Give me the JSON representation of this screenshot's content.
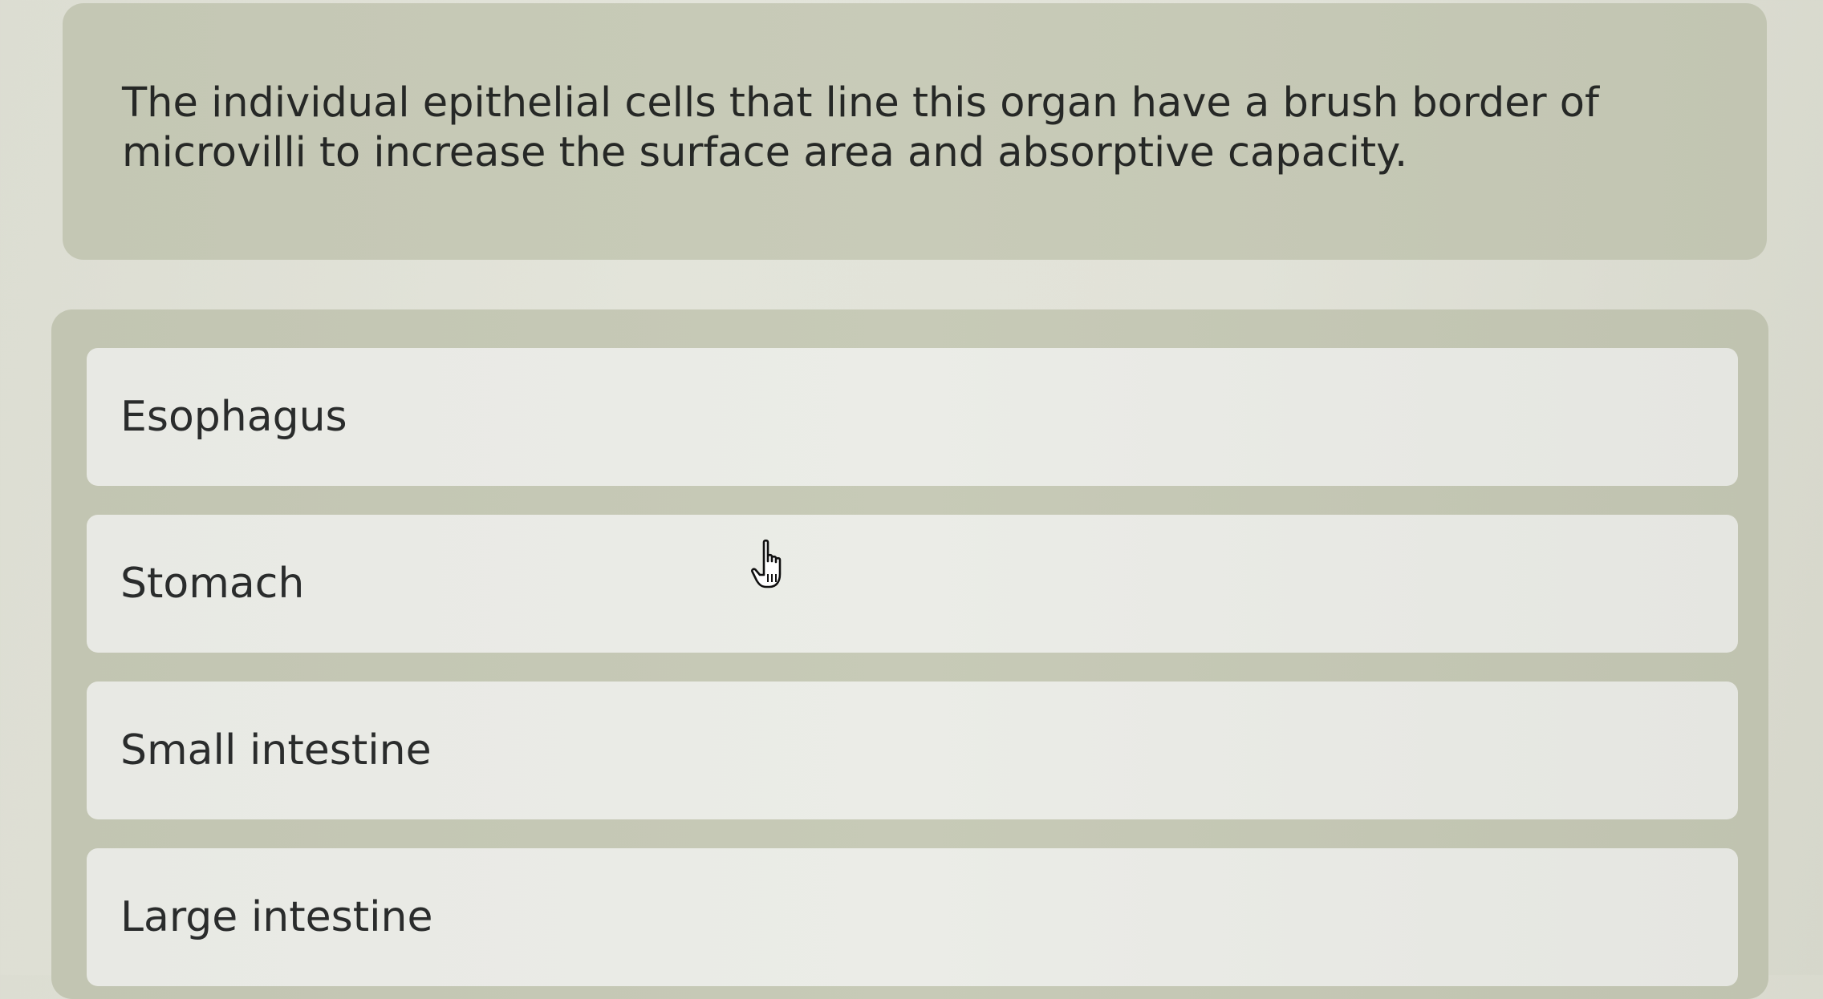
{
  "question": {
    "text": "The individual epithelial cells that line this organ have a brush border of microvilli to increase the surface area and absorptive capacity."
  },
  "options": [
    {
      "label": "Esophagus"
    },
    {
      "label": "Stomach"
    },
    {
      "label": "Small intestine"
    },
    {
      "label": "Large intestine"
    }
  ],
  "cursor": {
    "icon": "hand-pointer-icon"
  },
  "colors": {
    "background": "#e0e1d7",
    "question_card": "#c6c9b6",
    "option_background": "#e9eae5",
    "text": "#262826"
  }
}
